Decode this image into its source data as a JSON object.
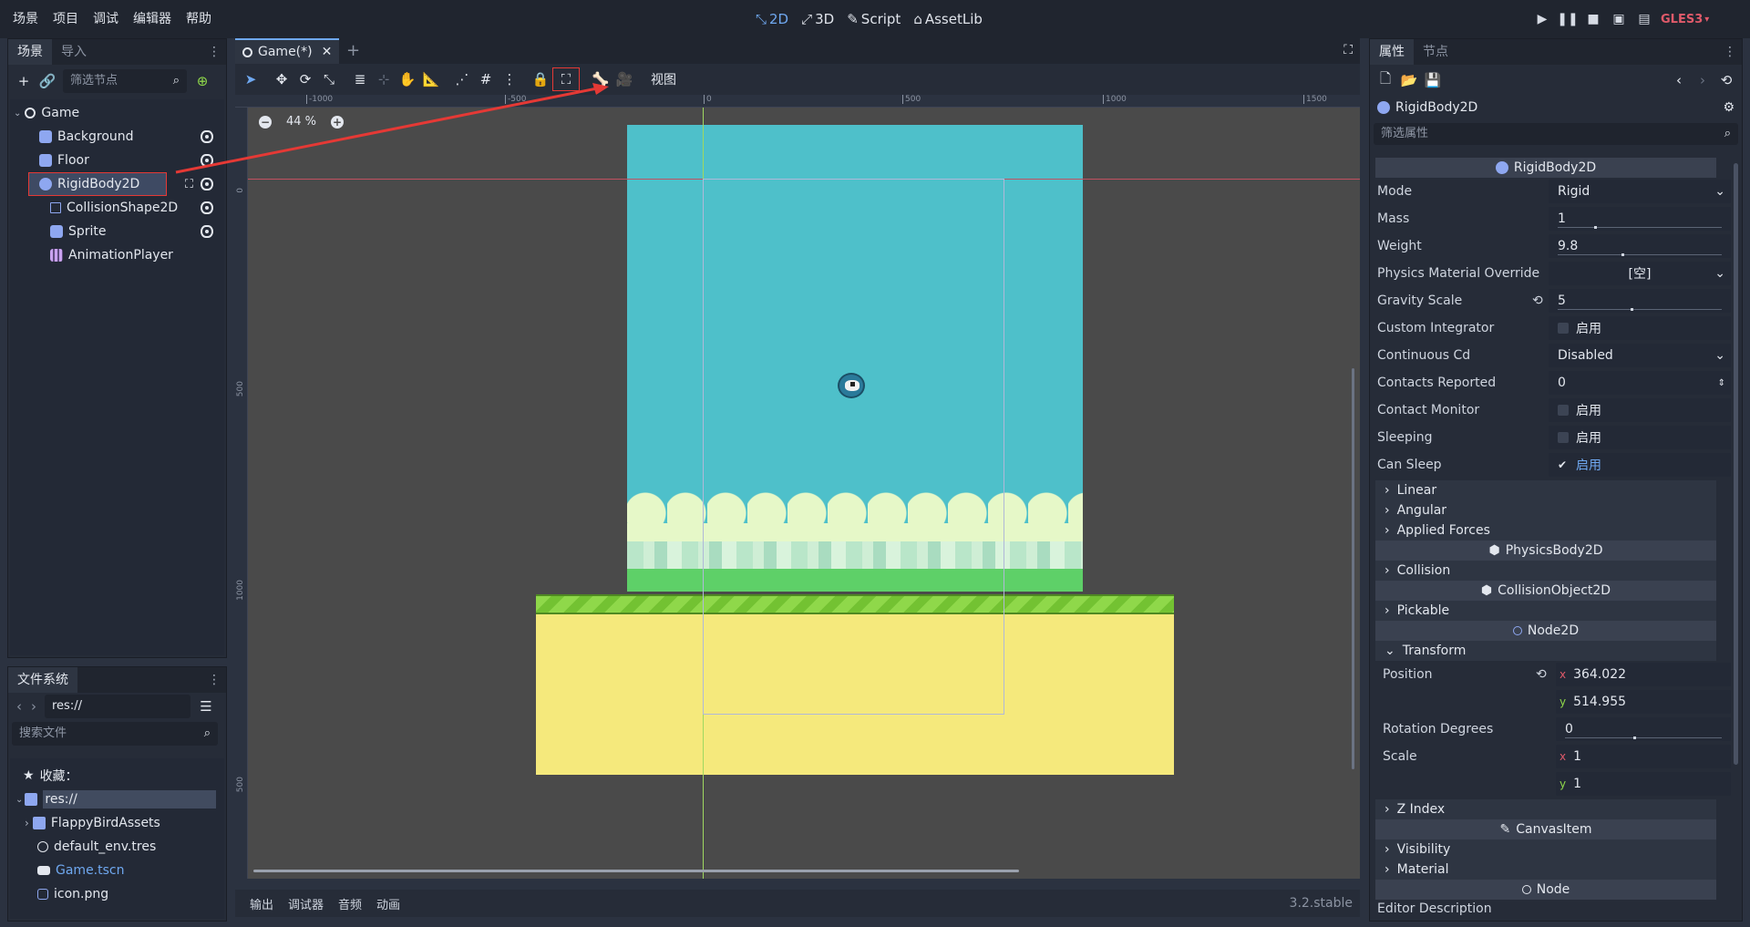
{
  "menu": [
    "场景",
    "项目",
    "调试",
    "编辑器",
    "帮助"
  ],
  "workspaces": [
    {
      "label": "2D",
      "icon": "2d-icon",
      "active": true
    },
    {
      "label": "3D",
      "icon": "3d-icon",
      "active": false
    },
    {
      "label": "Script",
      "icon": "script-icon",
      "active": false
    },
    {
      "label": "AssetLib",
      "icon": "assetlib-icon",
      "active": false
    }
  ],
  "renderer": "GLES3",
  "scene_dock": {
    "tabs": [
      "场景",
      "导入"
    ],
    "filter_placeholder": "筛选节点",
    "tree": [
      {
        "label": "Game",
        "icon": "node2d-icon",
        "level": 0
      },
      {
        "label": "Background",
        "icon": "sprite-icon",
        "level": 1,
        "visible": true
      },
      {
        "label": "Floor",
        "icon": "sprite-icon",
        "level": 1,
        "visible": true
      },
      {
        "label": "RigidBody2D",
        "icon": "rigidbody-icon",
        "level": 1,
        "visible": true,
        "selected": true
      },
      {
        "label": "CollisionShape2D",
        "icon": "collisionshape-icon",
        "level": 2,
        "visible": true
      },
      {
        "label": "Sprite",
        "icon": "sprite-icon",
        "level": 2,
        "visible": true
      },
      {
        "label": "AnimationPlayer",
        "icon": "animationplayer-icon",
        "level": 2
      }
    ]
  },
  "filesystem_dock": {
    "tab": "文件系统",
    "path": "res://",
    "search_placeholder": "搜索文件",
    "items": [
      {
        "label": "收藏：",
        "icon": "star-icon",
        "level": 0
      },
      {
        "label": "res://",
        "icon": "folder-icon",
        "level": 0,
        "selected": true
      },
      {
        "label": "FlappyBirdAssets",
        "icon": "folder-icon",
        "level": 1
      },
      {
        "label": "default_env.tres",
        "icon": "environment-icon",
        "level": 1
      },
      {
        "label": "Game.tscn",
        "icon": "scene-icon",
        "level": 1,
        "highlight": true
      },
      {
        "label": "icon.png",
        "icon": "image-icon",
        "level": 1
      }
    ]
  },
  "editor": {
    "tab": "Game(*)",
    "view_menu": "视图",
    "zoom": "44 %",
    "ruler_h": [
      "-1000",
      "-500",
      "0",
      "500",
      "1000",
      "1500"
    ],
    "ruler_v": [
      "0",
      "500",
      "1000",
      "500"
    ],
    "bottom_tabs": [
      "输出",
      "调试器",
      "音频",
      "动画"
    ],
    "version": "3.2.stable"
  },
  "inspector": {
    "tabs": [
      "属性",
      "节点"
    ],
    "object": "RigidBody2D",
    "filter_placeholder": "筛选属性",
    "sections": {
      "rigidbody": "RigidBody2D",
      "physicsbody": "PhysicsBody2D",
      "collisionobject": "CollisionObject2D",
      "node2d": "Node2D",
      "canvasitem": "CanvasItem",
      "node": "Node"
    },
    "props": {
      "mode": {
        "label": "Mode",
        "value": "Rigid"
      },
      "mass": {
        "label": "Mass",
        "value": "1"
      },
      "weight": {
        "label": "Weight",
        "value": "9.8"
      },
      "physics_material": {
        "label": "Physics Material Override",
        "value": "[空]"
      },
      "gravity_scale": {
        "label": "Gravity Scale",
        "value": "5"
      },
      "custom_integrator": {
        "label": "Custom Integrator",
        "value": "启用"
      },
      "continuous_cd": {
        "label": "Continuous Cd",
        "value": "Disabled"
      },
      "contacts_reported": {
        "label": "Contacts Reported",
        "value": "0"
      },
      "contact_monitor": {
        "label": "Contact Monitor",
        "value": "启用"
      },
      "sleeping": {
        "label": "Sleeping",
        "value": "启用"
      },
      "can_sleep": {
        "label": "Can Sleep",
        "value": "启用"
      },
      "position": {
        "label": "Position",
        "x": "364.022",
        "y": "514.955"
      },
      "rotation": {
        "label": "Rotation Degrees",
        "value": "0"
      },
      "scale": {
        "label": "Scale",
        "x": "1",
        "y": "1"
      },
      "editor_description": {
        "label": "Editor Description"
      }
    },
    "folds": {
      "linear": "Linear",
      "angular": "Angular",
      "applied_forces": "Applied Forces",
      "collision": "Collision",
      "pickable": "Pickable",
      "transform": "Transform",
      "z_index": "Z Index",
      "visibility": "Visibility",
      "material": "Material"
    },
    "axis": {
      "x": "x",
      "y": "y"
    }
  },
  "colors": {
    "accent": "#6fa8f0",
    "sky": "#4ec0ca",
    "ground": "#f5e97c",
    "grass": "#8fd84a",
    "bush": "#5ed068",
    "annotation": "#e53935"
  }
}
